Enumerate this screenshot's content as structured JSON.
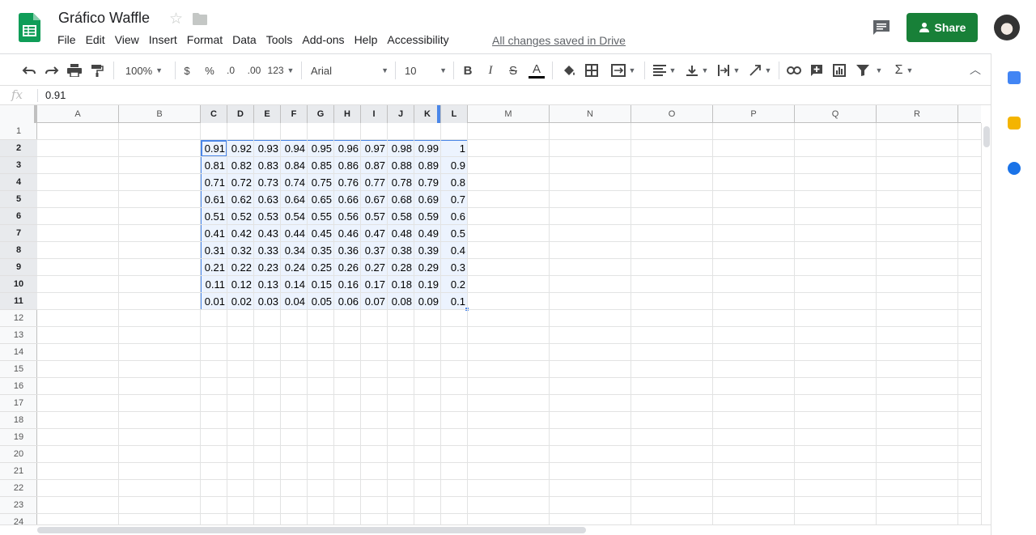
{
  "header": {
    "doc_title": "Gráfico Waffle",
    "menu": [
      "File",
      "Edit",
      "View",
      "Insert",
      "Format",
      "Data",
      "Tools",
      "Add-ons",
      "Help",
      "Accessibility"
    ],
    "save_status": "All changes saved in Drive",
    "share_label": "Share",
    "brand_color": "#188038"
  },
  "toolbar": {
    "zoom": "100%",
    "currency": "$",
    "percent": "%",
    "decrease_decimal": ".0",
    "increase_decimal": ".00",
    "more_formats": "123",
    "font": "Arial",
    "font_size": "10",
    "bold": "B",
    "italic": "I",
    "strike": "S",
    "text_color": "A",
    "sum": "Σ"
  },
  "formula_bar": {
    "fx": "fx",
    "value": "0.91"
  },
  "grid": {
    "columns": [
      "A",
      "B",
      "C",
      "D",
      "E",
      "F",
      "G",
      "H",
      "I",
      "J",
      "K",
      "L",
      "M",
      "N",
      "O",
      "P",
      "Q",
      "R"
    ],
    "rows": [
      "1",
      "2",
      "3",
      "4",
      "5",
      "6",
      "7",
      "8",
      "9",
      "10",
      "11",
      "12",
      "13",
      "14",
      "15",
      "16",
      "17",
      "18",
      "19",
      "20",
      "21",
      "22",
      "23",
      "24"
    ],
    "data": [
      [
        "0.91",
        "0.92",
        "0.93",
        "0.94",
        "0.95",
        "0.96",
        "0.97",
        "0.98",
        "0.99",
        "1"
      ],
      [
        "0.81",
        "0.82",
        "0.83",
        "0.84",
        "0.85",
        "0.86",
        "0.87",
        "0.88",
        "0.89",
        "0.9"
      ],
      [
        "0.71",
        "0.72",
        "0.73",
        "0.74",
        "0.75",
        "0.76",
        "0.77",
        "0.78",
        "0.79",
        "0.8"
      ],
      [
        "0.61",
        "0.62",
        "0.63",
        "0.64",
        "0.65",
        "0.66",
        "0.67",
        "0.68",
        "0.69",
        "0.7"
      ],
      [
        "0.51",
        "0.52",
        "0.53",
        "0.54",
        "0.55",
        "0.56",
        "0.57",
        "0.58",
        "0.59",
        "0.6"
      ],
      [
        "0.41",
        "0.42",
        "0.43",
        "0.44",
        "0.45",
        "0.46",
        "0.47",
        "0.48",
        "0.49",
        "0.5"
      ],
      [
        "0.31",
        "0.32",
        "0.33",
        "0.34",
        "0.35",
        "0.36",
        "0.37",
        "0.38",
        "0.39",
        "0.4"
      ],
      [
        "0.21",
        "0.22",
        "0.23",
        "0.24",
        "0.25",
        "0.26",
        "0.27",
        "0.28",
        "0.29",
        "0.3"
      ],
      [
        "0.11",
        "0.12",
        "0.13",
        "0.14",
        "0.15",
        "0.16",
        "0.17",
        "0.18",
        "0.19",
        "0.2"
      ],
      [
        "0.01",
        "0.02",
        "0.03",
        "0.04",
        "0.05",
        "0.06",
        "0.07",
        "0.08",
        "0.09",
        "0.1"
      ]
    ],
    "selection_color": "#4a86e8"
  }
}
